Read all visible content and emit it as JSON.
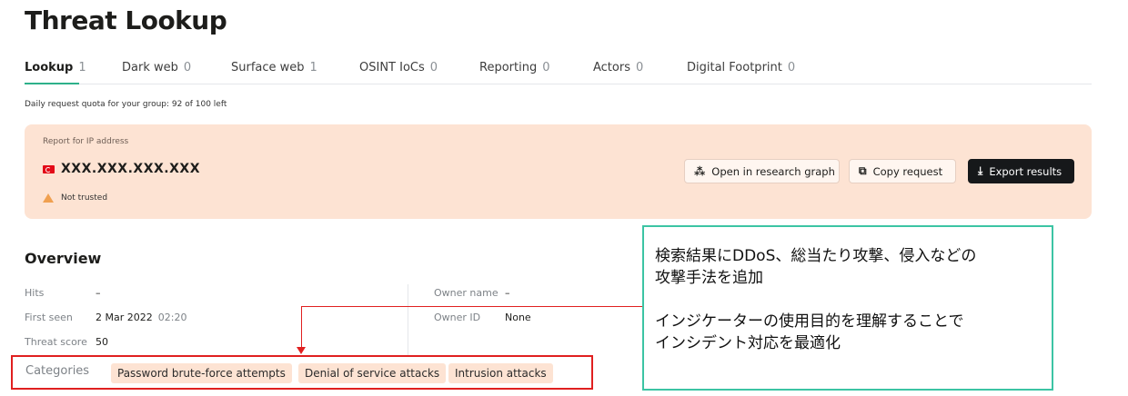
{
  "page": {
    "title": "Threat Lookup"
  },
  "tabs": [
    {
      "label": "Lookup",
      "count": "1"
    },
    {
      "label": "Dark web",
      "count": "0"
    },
    {
      "label": "Surface web",
      "count": "1"
    },
    {
      "label": "OSINT IoCs",
      "count": "0"
    },
    {
      "label": "Reporting",
      "count": "0"
    },
    {
      "label": "Actors",
      "count": "0"
    },
    {
      "label": "Digital Footprint",
      "count": "0"
    }
  ],
  "quota": "Daily request quota for your group: 92 of 100 left",
  "report": {
    "label": "Report for IP address",
    "ip": "XXX.XXX.XXX.XXX",
    "trust": "Not trusted",
    "buttons": {
      "graph": "Open in research graph",
      "copy": "Copy request",
      "export": "Export results"
    }
  },
  "overview": {
    "title": "Overview",
    "left": [
      {
        "label": "Hits",
        "value": "–"
      },
      {
        "label": "First seen",
        "value": "2 Mar 2022",
        "extra": "02:20"
      },
      {
        "label": "Threat score",
        "value": "50"
      }
    ],
    "right": [
      {
        "label": "Owner name",
        "value": "–"
      },
      {
        "label": "Owner ID",
        "value": "None"
      }
    ],
    "categories_label": "Categories",
    "categories": [
      "Password brute-force attempts",
      "Denial of service attacks",
      "Intrusion attacks"
    ]
  },
  "callout": {
    "line1": "検索結果にDDoS、総当たり攻撃、侵入などの",
    "line2": "攻撃手法を追加",
    "line3": "インジケーターの使用目的を理解することで",
    "line4": "インシデント対応を最適化"
  },
  "colors": {
    "accent": "#2db08a",
    "report_bg": "#fde3d3",
    "highlight_red": "#e02020",
    "callout_border": "#3cc4a4"
  }
}
